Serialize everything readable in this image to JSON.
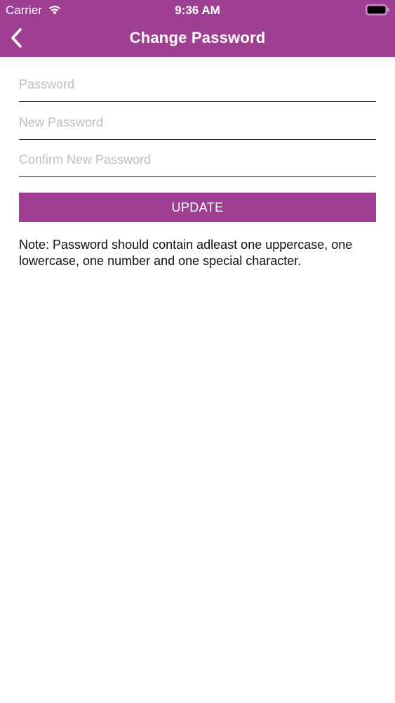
{
  "status_bar": {
    "carrier": "Carrier",
    "time": "9:36 AM",
    "icons": [
      "wifi-icon",
      "battery-icon"
    ]
  },
  "navbar": {
    "title": "Change Password",
    "back_icon": "chevron-left-icon"
  },
  "form": {
    "password": {
      "value": "",
      "placeholder": "Password"
    },
    "new_password": {
      "value": "",
      "placeholder": "New Password"
    },
    "confirm_new_password": {
      "value": "",
      "placeholder": "Confirm New Password"
    }
  },
  "update_button": {
    "label": "UPDATE"
  },
  "note": "Note: Password should contain adleast one uppercase, one lowercase, one number and one special character.",
  "colors": {
    "accent": "#9E3F94",
    "placeholder": "#BDBDC3",
    "text": "#111111",
    "background": "#FFFFFF"
  }
}
